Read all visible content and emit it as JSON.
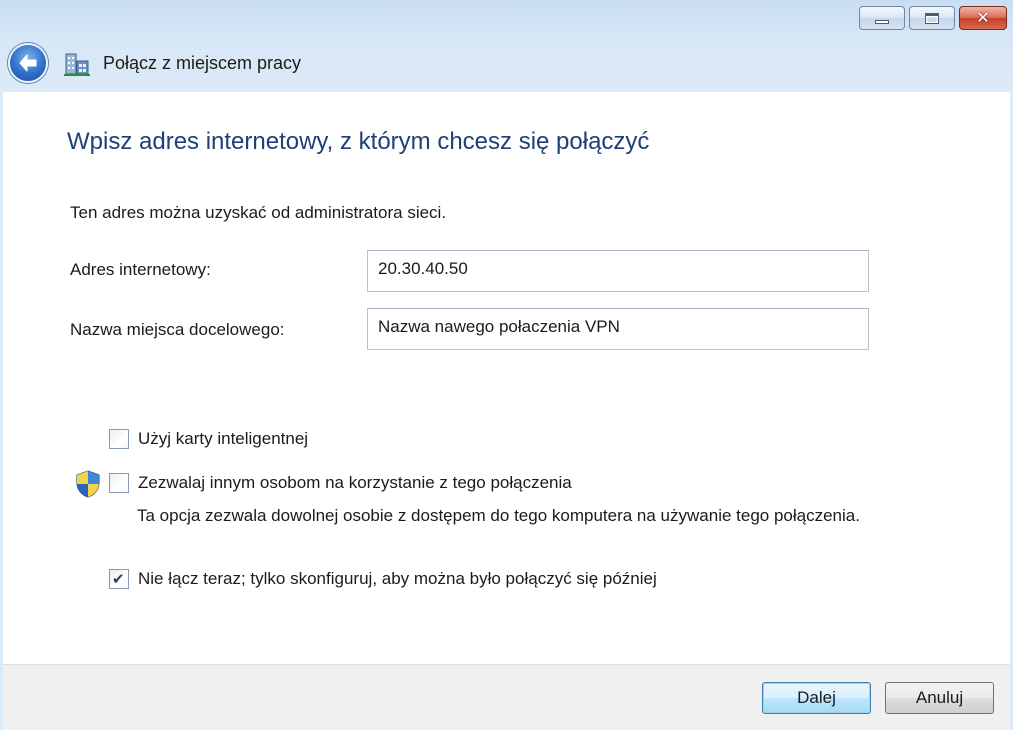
{
  "window": {
    "title": "Połącz z miejscem pracy",
    "caption_buttons": {
      "minimize": "minimize-icon",
      "maximize": "maximize-icon",
      "close": "close-icon"
    }
  },
  "nav": {
    "back_icon": "back-arrow-icon",
    "app_icon": "workplace-network-icon"
  },
  "page": {
    "heading": "Wpisz adres internetowy, z którym chcesz się połączyć",
    "info": "Ten adres można uzyskać od administratora sieci."
  },
  "form": {
    "address": {
      "label": "Adres internetowy:",
      "value": "20.30.40.50"
    },
    "destination": {
      "label": "Nazwa miejsca docelowego:",
      "value": "Nazwa nawego połaczenia VPN"
    }
  },
  "options": {
    "smart_card": {
      "label": "Użyj karty inteligentnej",
      "checked": false
    },
    "allow_others": {
      "label": "Zezwalaj innym osobom na korzystanie z tego połączenia",
      "checked": false,
      "description": "Ta opcja zezwala dowolnej osobie z dostępem do tego komputera na używanie tego połączenia.",
      "icon": "uac-shield-icon"
    },
    "dont_connect": {
      "label": "Nie łącz teraz; tylko skonfiguruj, aby można było połączyć się później",
      "checked": true
    }
  },
  "footer": {
    "next_label": "Dalej",
    "cancel_label": "Anuluj"
  },
  "colors": {
    "heading": "#1e3f78",
    "primary_button_border": "#3c7fb1",
    "close_button": "#c4402a"
  }
}
